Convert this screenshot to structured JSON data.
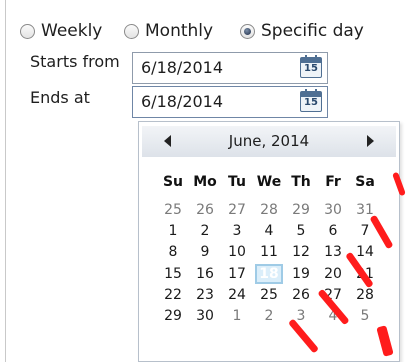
{
  "schedule": {
    "options": [
      {
        "label": "Weekly",
        "checked": false
      },
      {
        "label": "Monthly",
        "checked": false
      },
      {
        "label": "Specific day",
        "checked": true
      }
    ],
    "starts_from": {
      "label": "Starts from",
      "value": "6/18/2014",
      "icon": "calendar-icon",
      "icon_number": "15"
    },
    "ends_at": {
      "label": "Ends at",
      "value": "6/18/2014",
      "icon": "calendar-icon",
      "icon_number": "15"
    }
  },
  "calendar": {
    "month_title": "June, 2014",
    "prev_icon": "arrow-left-icon",
    "next_icon": "arrow-right-icon",
    "weekdays": [
      "Su",
      "Mo",
      "Tu",
      "We",
      "Th",
      "Fr",
      "Sa"
    ],
    "weeks": [
      [
        "25",
        "26",
        "27",
        "28",
        "29",
        "30",
        "31"
      ],
      [
        "1",
        "2",
        "3",
        "4",
        "5",
        "6",
        "7"
      ],
      [
        "8",
        "9",
        "10",
        "11",
        "12",
        "13",
        "14"
      ],
      [
        "15",
        "16",
        "17",
        "18",
        "19",
        "20",
        "21"
      ],
      [
        "22",
        "23",
        "24",
        "25",
        "26",
        "27",
        "28"
      ],
      [
        "29",
        "30",
        "1",
        "2",
        "3",
        "4",
        "5"
      ]
    ],
    "selected": "18"
  },
  "colors": {
    "watermark": "#ff1c1c",
    "accent": "#4f6f93",
    "selected_fill": "#dbeefa"
  }
}
